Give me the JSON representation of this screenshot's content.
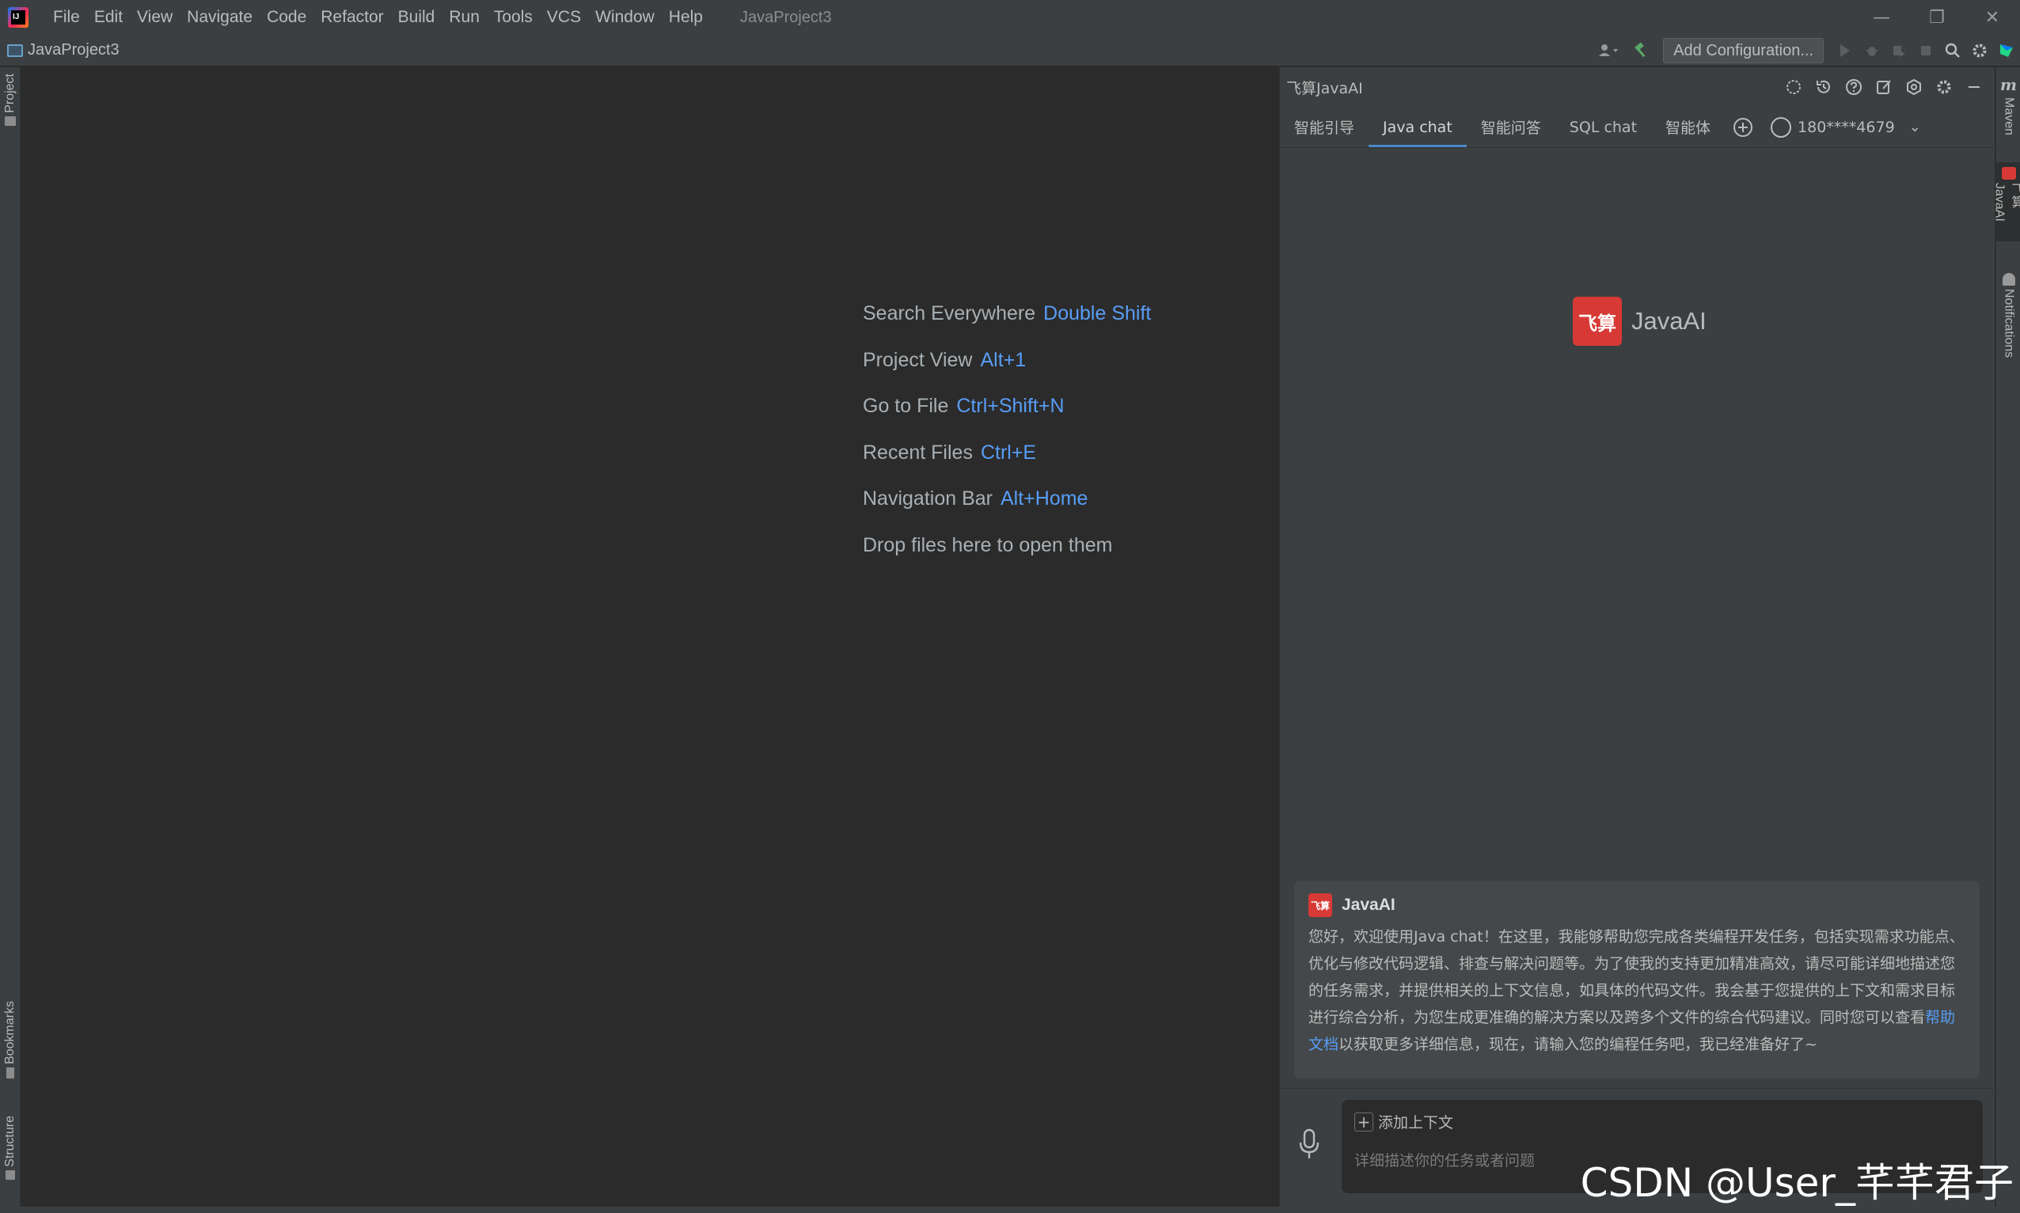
{
  "window": {
    "title": "JavaProject3",
    "menu": [
      "File",
      "Edit",
      "View",
      "Navigate",
      "Code",
      "Refactor",
      "Build",
      "Run",
      "Tools",
      "VCS",
      "Window",
      "Help"
    ],
    "logo_text": "IJ"
  },
  "navbar": {
    "project_name": "JavaProject3",
    "add_configuration_label": "Add Configuration..."
  },
  "left_strip": {
    "project_label": "Project",
    "bookmarks_label": "Bookmarks",
    "structure_label": "Structure"
  },
  "editor": {
    "hints": [
      {
        "label": "Search Everywhere",
        "key": "Double Shift"
      },
      {
        "label": "Project View",
        "key": "Alt+1"
      },
      {
        "label": "Go to File",
        "key": "Ctrl+Shift+N"
      },
      {
        "label": "Recent Files",
        "key": "Ctrl+E"
      },
      {
        "label": "Navigation Bar",
        "key": "Alt+Home"
      },
      {
        "label": "Drop files here to open them",
        "key": ""
      }
    ]
  },
  "ai_panel": {
    "title": "飞算JavaAI",
    "tabs": [
      {
        "label": "智能引导",
        "active": false
      },
      {
        "label": "Java chat",
        "active": true
      },
      {
        "label": "智能问答",
        "active": false
      },
      {
        "label": "SQL chat",
        "active": false
      },
      {
        "label": "智能体",
        "active": false
      }
    ],
    "account": "180****4679",
    "brand_logo_text": "飞算",
    "brand_name": "JavaAI",
    "welcome": {
      "sender": "JavaAI",
      "message": "您好，欢迎使用Java chat！在这里，我能够帮助您完成各类编程开发任务，包括实现需求功能点、优化与修改代码逻辑、排查与解决问题等。为了使我的支持更加精准高效，请尽可能详细地描述您的任务需求，并提供相关的上下文信息，如具体的代码文件。我会基于您提供的上下文和需求目标进行综合分析，为您生成更准确的解决方案以及跨多个文件的综合代码建议。同时您可以查看",
      "link_text": "帮助文档",
      "message_tail": "以获取更多详细信息，现在，请输入您的编程任务吧，我已经准备好了~"
    },
    "add_context_label": "添加上下文",
    "input_placeholder": "详细描述你的任务或者问题"
  },
  "right_strip": {
    "maven_label": "Maven",
    "javaai_label": "飞算JavaAI",
    "notifications_label": "Notifications"
  },
  "watermark": "CSDN @User_芊芊君子",
  "colors": {
    "background": "#2b2b2b",
    "panel": "#3c3f41",
    "accent_blue": "#589df6",
    "brand_red": "#d73a36"
  }
}
